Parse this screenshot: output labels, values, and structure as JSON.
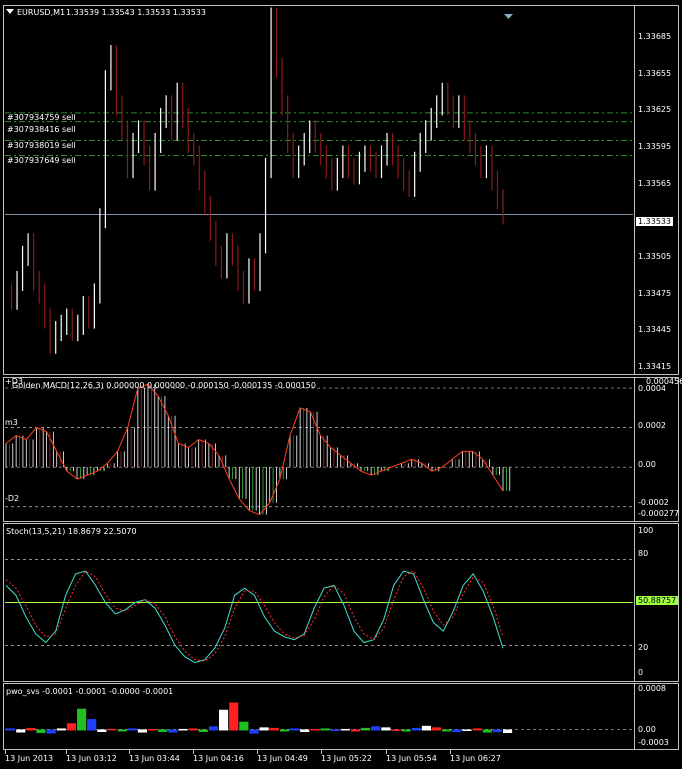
{
  "header": {
    "symbol": "EURUSD,M1",
    "values": "1.33539 1.33543 1.33533 1.33533"
  },
  "orders": [
    {
      "label": "#307934759 sell",
      "price": 1.33614
    },
    {
      "label": "#307938416 sell",
      "price": 1.33607
    },
    {
      "label": "#307938019 sell",
      "price": 1.33592
    },
    {
      "label": "#307937649 sell",
      "price": 1.3358
    }
  ],
  "price_scale": [
    "1.33685",
    "1.33655",
    "1.33625",
    "1.33595",
    "1.33565",
    "1.33535",
    "1.33505",
    "1.33475",
    "1.33445",
    "1.33415"
  ],
  "current_price": "1.33533",
  "macd": {
    "title": "Golden MACD(12,26,3) 0.000000 0.000000 -0.000150 -0.000135 -0.000150",
    "top_label": "+D3",
    "m_label": "m3",
    "bottom_label": "-D2",
    "scale": [
      "0.000456",
      "0.0004",
      "0.0002",
      "0.00",
      "-0.0002",
      "-0.000277"
    ]
  },
  "stoch": {
    "title": "Stoch(13,5,21) 18.8679 22.5070",
    "scale": [
      "100",
      "80",
      "20",
      "0"
    ],
    "current": "50.88757"
  },
  "pwo": {
    "title": "pwo_svs -0.0001 -0.0001 -0.0000 -0.0001",
    "scale": [
      "0.0008",
      "0.00",
      "-0.0003"
    ]
  },
  "time_axis": [
    "13 Jun 2013",
    "13 Jun 03:12",
    "13 Jun 03:44",
    "13 Jun 04:16",
    "13 Jun 04:49",
    "13 Jun 05:22",
    "13 Jun 05:54",
    "13 Jun 06:27"
  ],
  "colors": {
    "bull": "#ffffff",
    "bear": "#8b1a1a",
    "grid": "#c0c0c0",
    "order_line": "#2e8b2e",
    "signal": "#ff3030",
    "main_line": "#40e0d0",
    "accent": "#a0ff40"
  },
  "icons": {
    "menu": "triangle-down-icon",
    "shift": "triangle-down-icon"
  },
  "chart_data": [
    {
      "type": "candlestick",
      "title": "EURUSD,M1",
      "ylim": [
        1.33405,
        1.337
      ],
      "x": [
        "13 Jun 2013",
        "13 Jun 03:12",
        "13 Jun 03:44",
        "13 Jun 04:16",
        "13 Jun 04:49",
        "13 Jun 05:22",
        "13 Jun 05:54",
        "13 Jun 06:27"
      ],
      "close_path": [
        1.3347,
        1.33465,
        1.3348,
        1.335,
        1.3351,
        1.3348,
        1.3347,
        1.3345,
        1.3343,
        1.3344,
        1.33445,
        1.3345,
        1.3344,
        1.33445,
        1.3346,
        1.3345,
        1.3347,
        1.3353,
        1.3364,
        1.3366,
        1.3362,
        1.336,
        1.3357,
        1.3359,
        1.336,
        1.3358,
        1.3356,
        1.3359,
        1.3361,
        1.3362,
        1.336,
        1.3363,
        1.3361,
        1.3359,
        1.3358,
        1.3356,
        1.3354,
        1.3352,
        1.335,
        1.3349,
        1.3351,
        1.335,
        1.3348,
        1.3347,
        1.3349,
        1.3348,
        1.3351,
        1.3357,
        1.3369,
        1.3365,
        1.3362,
        1.3359,
        1.3357,
        1.3358,
        1.3359,
        1.336,
        1.3359,
        1.3358,
        1.3357,
        1.3356,
        1.3357,
        1.3358,
        1.3357,
        1.33565,
        1.33575,
        1.3358,
        1.33575,
        1.3357,
        1.3358,
        1.3359,
        1.3358,
        1.3357,
        1.3356,
        1.33555,
        1.33575,
        1.3359,
        1.336,
        1.3361,
        1.3362,
        1.3363,
        1.3362,
        1.3361,
        1.3362,
        1.336,
        1.3359,
        1.3358,
        1.3357,
        1.3358,
        1.3356,
        1.33545,
        1.33533
      ]
    },
    {
      "type": "bar",
      "title": "Golden MACD(12,26,3)",
      "ylim": [
        -0.000277,
        0.000456
      ],
      "values": [
        0.00012,
        0.00016,
        0.00014,
        0.0002,
        0.00018,
        8e-05,
        -2e-05,
        -6e-05,
        -4e-05,
        -2e-05,
        2e-05,
        8e-05,
        0.0002,
        0.0004,
        0.00042,
        0.00036,
        0.00026,
        0.00012,
        0.0001,
        0.00014,
        0.00012,
        6e-05,
        -6e-05,
        -0.00016,
        -0.00022,
        -0.00024,
        -0.00018,
        -6e-05,
        0.00016,
        0.0003,
        0.00028,
        0.00016,
        0.0001,
        6e-05,
        2e-05,
        -2e-05,
        -4e-05,
        -2e-05,
        0.0,
        2e-05,
        4e-05,
        2e-05,
        -2e-05,
        0.0,
        4e-05,
        8e-05,
        8e-05,
        4e-05,
        -4e-05,
        -0.00012
      ]
    },
    {
      "type": "line",
      "title": "Stoch(13,5,21)",
      "ylim": [
        0,
        100
      ],
      "series": [
        {
          "name": "main",
          "values": [
            62,
            55,
            40,
            28,
            22,
            30,
            55,
            70,
            72,
            62,
            50,
            42,
            45,
            50,
            52,
            46,
            34,
            20,
            12,
            8,
            10,
            18,
            32,
            55,
            60,
            55,
            40,
            30,
            26,
            24,
            28,
            46,
            60,
            62,
            48,
            30,
            22,
            24,
            38,
            62,
            72,
            70,
            52,
            36,
            30,
            44,
            62,
            70,
            58,
            40,
            18
          ]
        },
        {
          "name": "signal",
          "values": [
            66,
            60,
            48,
            34,
            26,
            28,
            46,
            62,
            72,
            68,
            56,
            46,
            44,
            48,
            52,
            49,
            40,
            26,
            16,
            10,
            9,
            14,
            26,
            46,
            58,
            58,
            48,
            36,
            28,
            25,
            27,
            38,
            54,
            62,
            56,
            40,
            28,
            24,
            32,
            52,
            68,
            72,
            60,
            44,
            34,
            40,
            56,
            68,
            64,
            48,
            26
          ]
        }
      ]
    },
    {
      "type": "bar",
      "title": "pwo_svs",
      "ylim": [
        -0.0003,
        0.0008
      ],
      "values": [
        2e-05,
        -4e-05,
        3e-05,
        -5e-05,
        -6e-05,
        2e-05,
        0.00012,
        0.0004,
        0.0002,
        -3e-05,
        1e-05,
        -2e-05,
        2e-05,
        -4e-05,
        1e-05,
        -3e-05,
        -4e-05,
        1e-05,
        2e-05,
        -3e-05,
        6e-05,
        0.00038,
        0.00052,
        0.00015,
        -6e-05,
        4e-05,
        3e-05,
        -2e-05,
        2e-05,
        -3e-05,
        1e-05,
        2e-05,
        -1e-05,
        1e-05,
        -2e-05,
        3e-05,
        6e-05,
        4e-05,
        -1e-05,
        -2e-05,
        3e-05,
        7e-05,
        4e-05,
        -2e-05,
        -3e-05,
        -1e-05,
        2e-05,
        -4e-05,
        -3e-05,
        -5e-05
      ]
    }
  ]
}
